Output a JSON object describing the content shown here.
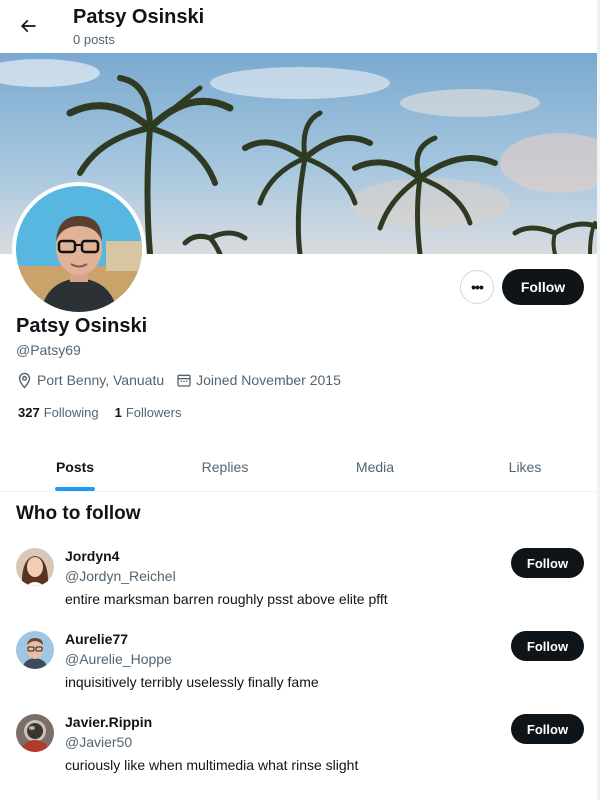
{
  "header": {
    "title": "Patsy Osinski",
    "subtitle": "0 posts"
  },
  "profile": {
    "name": "Patsy Osinski",
    "handle": "@Patsy69",
    "location": "Port Benny, Vanuatu",
    "joined": "Joined November 2015",
    "following_count": "327",
    "following_label": "Following",
    "followers_count": "1",
    "followers_label": "Followers",
    "more_label": "•••",
    "follow_label": "Follow"
  },
  "tabs": [
    {
      "label": "Posts",
      "active": true
    },
    {
      "label": "Replies",
      "active": false
    },
    {
      "label": "Media",
      "active": false
    },
    {
      "label": "Likes",
      "active": false
    }
  ],
  "who_to_follow": {
    "title": "Who to follow",
    "items": [
      {
        "name": "Jordyn4",
        "handle": "@Jordyn_Reichel",
        "bio": "entire marksman barren roughly psst above elite pfft",
        "follow_label": "Follow"
      },
      {
        "name": "Aurelie77",
        "handle": "@Aurelie_Hoppe",
        "bio": "inquisitively terribly uselessly finally fame",
        "follow_label": "Follow"
      },
      {
        "name": "Javier.Rippin",
        "handle": "@Javier50",
        "bio": "curiously like when multimedia what rinse slight",
        "follow_label": "Follow"
      }
    ]
  },
  "colors": {
    "accent": "#1d9bf0",
    "button": "#0f1419",
    "muted": "#536471"
  }
}
